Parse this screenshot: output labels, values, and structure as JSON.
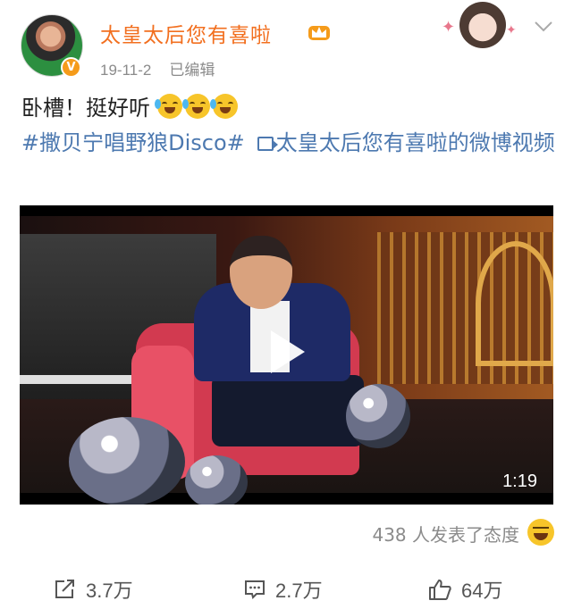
{
  "post": {
    "username": "太皇太后您有喜啦",
    "date": "19-11-2",
    "edited": "已编辑",
    "text": "卧槽！挺好听",
    "emoji_count": 3,
    "hashtag": "#撒贝宁唱野狼Disco#",
    "video_source": "太皇太后您有喜啦的微博视频"
  },
  "video": {
    "duration": "1:19"
  },
  "reactions": {
    "attitude_text": "438 人发表了态度"
  },
  "actions": {
    "share_count": "3.7万",
    "comment_count": "2.7万",
    "like_count": "64万"
  },
  "colors": {
    "username": "#f26f1f",
    "link": "#4d79b0",
    "meta": "#8b8b8b"
  },
  "icons": [
    "verified-badge-icon",
    "crown-icon",
    "chevron-down-icon",
    "cry-laugh-emoji-icon",
    "video-link-icon",
    "play-icon",
    "grin-emoji-icon",
    "share-icon",
    "comment-icon",
    "like-icon"
  ]
}
